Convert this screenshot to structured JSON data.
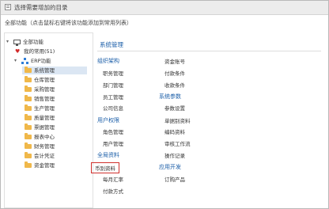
{
  "window": {
    "title": "选择需要增加的目录"
  },
  "subtitle": "全部功能（点击鼠标右键将该功能添加到常用列表）",
  "tree": {
    "root": "全部功能",
    "favorites": "我的常用(51)",
    "erp": "ERP功能",
    "modules": [
      "系统管理",
      "仓库管理",
      "采购管理",
      "销售管理",
      "生产管理",
      "质量管理",
      "票据管理",
      "报表中心",
      "财务管理",
      "会计凭证",
      "资金管理"
    ],
    "selected": "系统管理"
  },
  "panel": {
    "title": "系统管理",
    "col1": [
      {
        "type": "cat",
        "label": "组织架构"
      },
      {
        "type": "item",
        "label": "职务管理"
      },
      {
        "type": "item",
        "label": "部门管理"
      },
      {
        "type": "item",
        "label": "员工管理"
      },
      {
        "type": "item",
        "label": "公司信息"
      },
      {
        "type": "cat",
        "label": "用户权限"
      },
      {
        "type": "item",
        "label": "角色管理"
      },
      {
        "type": "item",
        "label": "用户管理"
      },
      {
        "type": "cat",
        "label": "全局资料"
      },
      {
        "type": "item",
        "label": "币别资料",
        "highlighted": true
      },
      {
        "type": "item",
        "label": "每月汇率"
      },
      {
        "type": "item",
        "label": "付款方式"
      }
    ],
    "col2": [
      {
        "type": "item",
        "label": "资金账号"
      },
      {
        "type": "item",
        "label": "付款条件"
      },
      {
        "type": "item",
        "label": "收款条件"
      },
      {
        "type": "cat",
        "label": "系统参数"
      },
      {
        "type": "item",
        "label": "参数设置"
      },
      {
        "type": "item",
        "label": "单据别资料"
      },
      {
        "type": "item",
        "label": "编码资料"
      },
      {
        "type": "item",
        "label": "审核工作流"
      },
      {
        "type": "item",
        "label": "操作记录"
      },
      {
        "type": "cat",
        "label": "应用开发"
      },
      {
        "type": "item",
        "label": "订购产品"
      }
    ]
  },
  "colors": {
    "accent": "#1b5ea8",
    "highlight": "#d0312d",
    "selected_bg": "#dbe6f3",
    "folder": "#f0b84a"
  }
}
